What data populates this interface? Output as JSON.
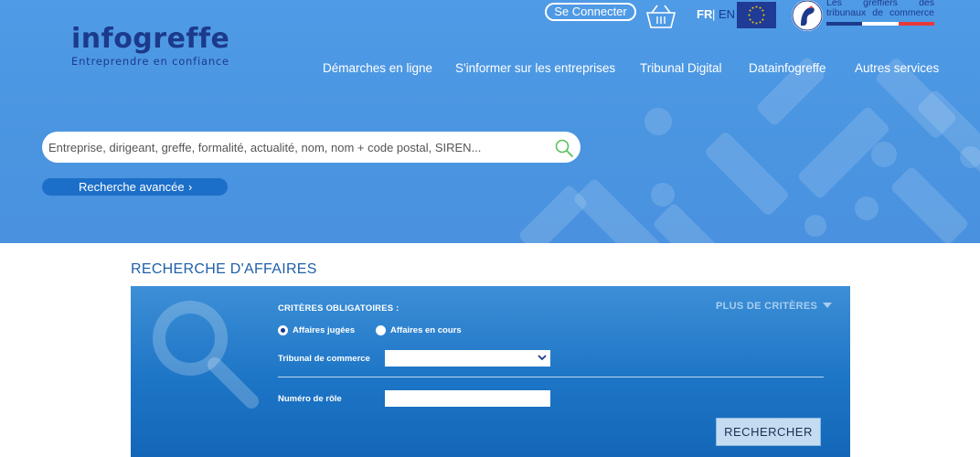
{
  "header": {
    "logo_name": "infogreffe",
    "logo_tagline": "Entreprendre en confiance",
    "connect_label": "Se Connecter",
    "basket_icon": "basket-icon",
    "lang_fr": "FR",
    "lang_separator": "|",
    "lang_en": "EN",
    "greffiers_text": "Les greffiers des tribunaux de commerce",
    "colors": {
      "brand": "#1c3a8c",
      "hero_bg": "#4f9be6",
      "accent": "#1c6fc8"
    }
  },
  "nav": {
    "items": [
      {
        "label": "Démarches en ligne"
      },
      {
        "label": "S'informer sur les entreprises"
      },
      {
        "label": "Tribunal Digital"
      },
      {
        "label": "Datainfogreffe"
      },
      {
        "label": "Autres services"
      }
    ]
  },
  "search": {
    "placeholder": "Entreprise, dirigeant, greffe, formalité, actualité, nom, nom + code postal, SIREN...",
    "value": "",
    "advanced_label": "Recherche avancée",
    "advanced_chevron": "›"
  },
  "section": {
    "title": "RECHERCHE D'AFFAIRES"
  },
  "form": {
    "mandatory_title": "CRITÈRES OBLIGATOIRES :",
    "more_criteria": "PLUS DE CRITÈRES",
    "radios": [
      {
        "label": "Affaires jugées",
        "checked": true
      },
      {
        "label": "Affaires en cours",
        "checked": false
      }
    ],
    "tribunal_label": "Tribunal de commerce",
    "tribunal_value": "",
    "role_label": "Numéro de rôle",
    "role_value": "",
    "submit_label": "RECHERCHER"
  }
}
